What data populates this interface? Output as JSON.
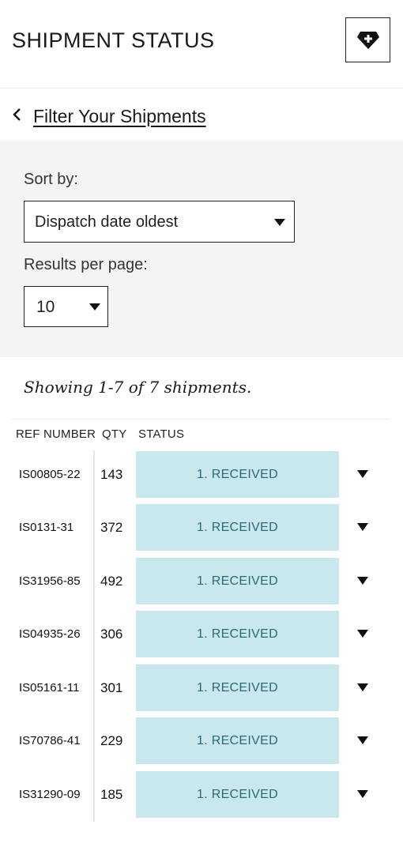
{
  "header": {
    "title": "SHIPMENT STATUS",
    "action_icon": "gem-plus-icon"
  },
  "filter_link": {
    "label": "Filter Your Shipments",
    "icon": "chevron-left-icon"
  },
  "filters": {
    "sort_label": "Sort by:",
    "sort_value": "Dispatch date oldest",
    "rpp_label": "Results per page:",
    "rpp_value": "10"
  },
  "results": {
    "summary": "Showing 1-7 of 7 shipments."
  },
  "table": {
    "columns": [
      "REF NUMBER",
      "QTY",
      "STATUS"
    ],
    "rows": [
      {
        "ref": "IS00805-22",
        "qty": "143",
        "status": "1. RECEIVED"
      },
      {
        "ref": "IS0131-31",
        "qty": "372",
        "status": "1. RECEIVED"
      },
      {
        "ref": "IS31956-85",
        "qty": "492",
        "status": "1. RECEIVED"
      },
      {
        "ref": "IS04935-26",
        "qty": "306",
        "status": "1. RECEIVED"
      },
      {
        "ref": "IS05161-11",
        "qty": "301",
        "status": "1. RECEIVED"
      },
      {
        "ref": "IS70786-41",
        "qty": "229",
        "status": "1. RECEIVED"
      },
      {
        "ref": "IS31290-09",
        "qty": "185",
        "status": "1. RECEIVED"
      }
    ]
  },
  "colors": {
    "status_bg": "#c8e8ee",
    "status_text": "#2a6a72",
    "panel_bg": "#f4f4f4"
  }
}
